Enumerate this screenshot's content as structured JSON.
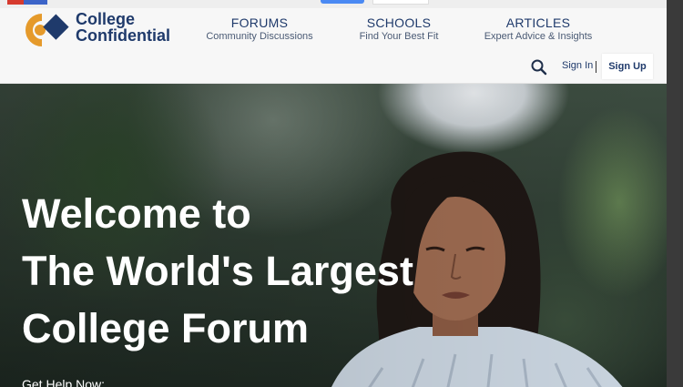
{
  "header": {
    "logo": {
      "line1": "College",
      "line2": "Confidential"
    },
    "nav": [
      {
        "title": "FORUMS",
        "subtitle": "Community Discussions"
      },
      {
        "title": "SCHOOLS",
        "subtitle": "Find Your Best Fit"
      },
      {
        "title": "ARTICLES",
        "subtitle": "Expert Advice & Insights"
      }
    ],
    "search_icon": "search-icon",
    "sign_in": "Sign In",
    "sign_up": "Sign Up"
  },
  "hero": {
    "headline": [
      "Welcome to",
      "The World's Largest",
      "College Forum"
    ],
    "cta_text": "Get Help Now:"
  },
  "colors": {
    "brand_navy": "#1f3a6b",
    "brand_orange": "#e59a2b",
    "header_bg": "#f7f7f7"
  }
}
